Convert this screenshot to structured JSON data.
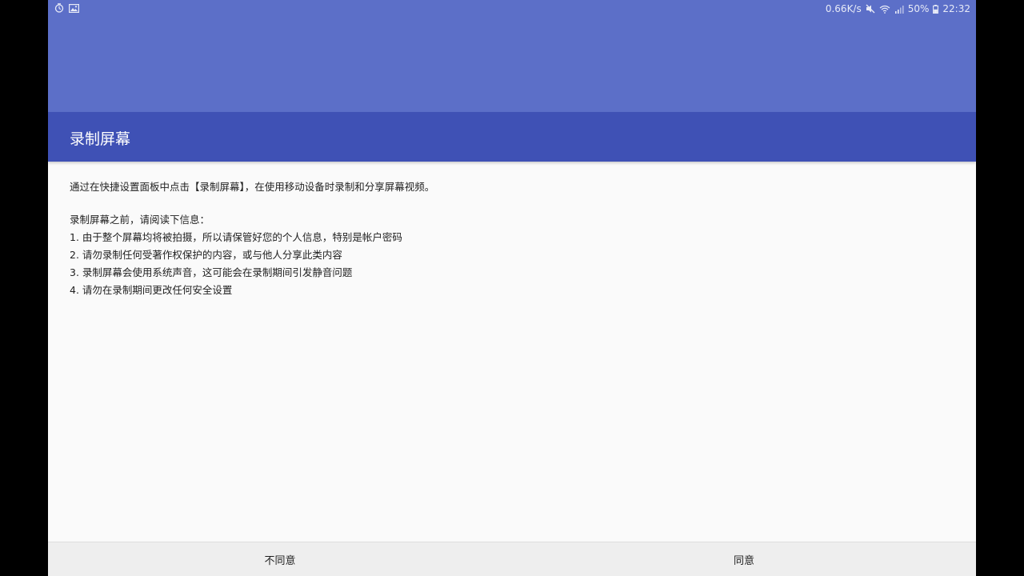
{
  "status_bar": {
    "left_icons": [
      "alarm-icon",
      "image-icon"
    ],
    "network_speed": "0.66K/s",
    "right_icons": [
      "mute-icon",
      "wifi-icon",
      "signal-icon"
    ],
    "battery": "50%",
    "time": "22:32"
  },
  "app_bar": {
    "title": "录制屏幕"
  },
  "content": {
    "intro": "通过在快捷设置面板中点击【录制屏幕】，在使用移动设备时录制和分享屏幕视频。",
    "notice_heading": "录制屏幕之前，请阅读下信息：",
    "notices": [
      "1. 由于整个屏幕均将被拍摄，所以请保管好您的个人信息，特别是帐户密码",
      "2. 请勿录制任何受著作权保护的内容，或与他人分享此类内容",
      "3. 录制屏幕会使用系统声音，这可能会在录制期间引发静音问题",
      "4. 请勿在录制期间更改任何安全设置"
    ]
  },
  "buttons": {
    "disagree": "不同意",
    "agree": "同意"
  },
  "colors": {
    "status_area": "#5c6fc8",
    "app_bar": "#3f51b5",
    "background": "#fafafa",
    "bottom_bar": "#eeeeee"
  }
}
